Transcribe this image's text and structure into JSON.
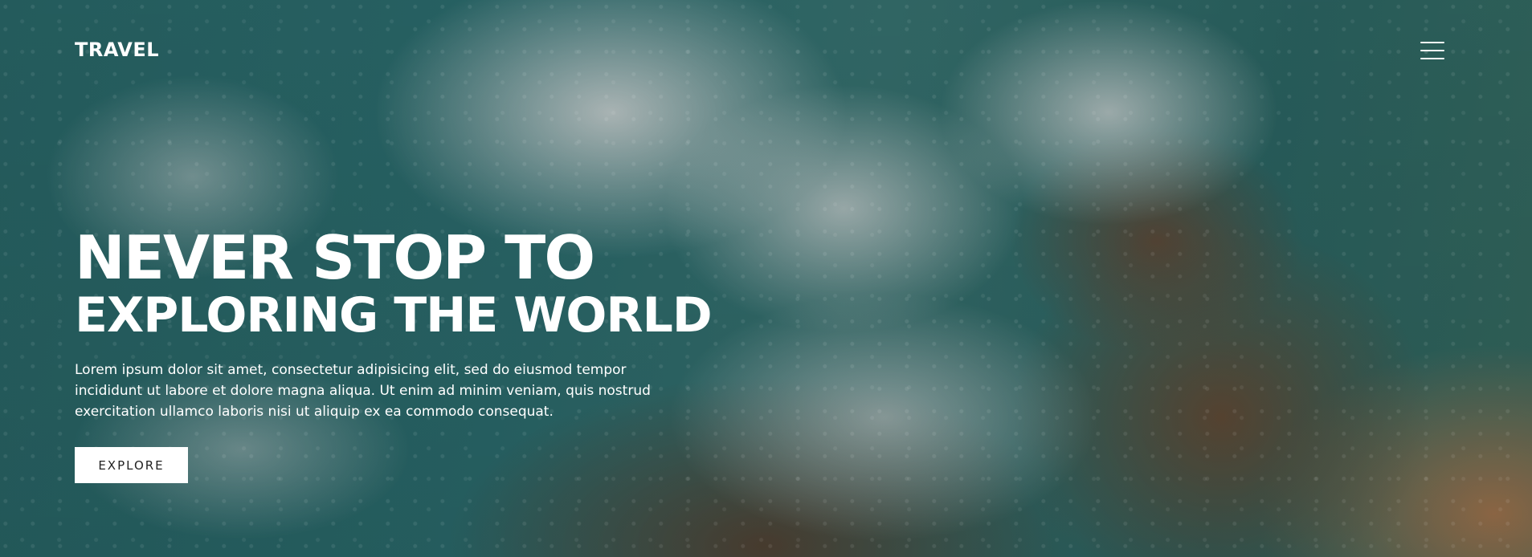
{
  "header": {
    "logo": "TRAVEL",
    "menu_icon": "hamburger-menu-icon"
  },
  "hero": {
    "headline_line1": "NEVER STOP TO",
    "headline_line2": "EXPLORING THE WORLD",
    "description": "Lorem ipsum dolor sit amet, consectetur adipisicing elit, sed do eiusmod tempor incididunt ut labore et dolore magna aliqua. Ut enim ad minim veniam, quis nostrud exercitation ullamco laboris nisi ut aliquip ex ea commodo consequat.",
    "button_label": "EXPLORE"
  },
  "colors": {
    "text": "#ffffff",
    "button_bg": "#ffffff",
    "button_text": "#222222",
    "sea": "#2f7678",
    "rock": "#6e523a",
    "sand": "#b08056"
  }
}
